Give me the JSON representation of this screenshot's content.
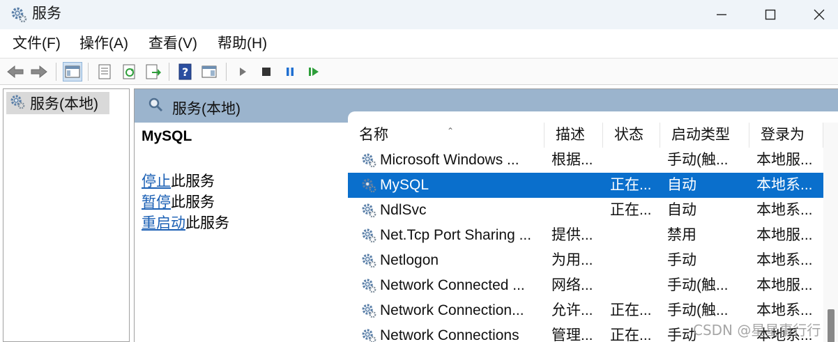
{
  "window": {
    "title": "服务"
  },
  "menu": [
    "文件(F)",
    "操作(A)",
    "查看(V)",
    "帮助(H)"
  ],
  "tree": {
    "node": "服务(本地)"
  },
  "pane": {
    "header": "服务(本地)"
  },
  "description": {
    "service_name": "MySQL",
    "actions": [
      {
        "link": "停止",
        "suffix": "此服务"
      },
      {
        "link": "暂停",
        "suffix": "此服务"
      },
      {
        "link": "重启动",
        "suffix": "此服务"
      }
    ]
  },
  "columns": [
    "名称",
    "描述",
    "状态",
    "启动类型",
    "登录为"
  ],
  "rows": [
    {
      "name": "Microsoft Windows ...",
      "desc": "根据...",
      "status": "",
      "startup": "手动(触...",
      "logon": "本地服...",
      "selected": false
    },
    {
      "name": "MySQL",
      "desc": "",
      "status": "正在...",
      "startup": "自动",
      "logon": "本地系...",
      "selected": true
    },
    {
      "name": "NdlSvc",
      "desc": "",
      "status": "正在...",
      "startup": "自动",
      "logon": "本地系...",
      "selected": false
    },
    {
      "name": "Net.Tcp Port Sharing ...",
      "desc": "提供...",
      "status": "",
      "startup": "禁用",
      "logon": "本地服...",
      "selected": false
    },
    {
      "name": "Netlogon",
      "desc": "为用...",
      "status": "",
      "startup": "手动",
      "logon": "本地系...",
      "selected": false
    },
    {
      "name": "Network Connected ...",
      "desc": "网络...",
      "status": "",
      "startup": "手动(触...",
      "logon": "本地服...",
      "selected": false
    },
    {
      "name": "Network Connection...",
      "desc": "允许...",
      "status": "正在...",
      "startup": "手动(触...",
      "logon": "本地系...",
      "selected": false
    },
    {
      "name": "Network Connections",
      "desc": "管理...",
      "status": "正在...",
      "startup": "手动",
      "logon": "本地系...",
      "selected": false
    }
  ],
  "watermark": "CSDN @星星事行行",
  "colors": {
    "selection": "#0a6fcc",
    "header_band": "#9bb4cd",
    "link": "#1a5fb4"
  }
}
